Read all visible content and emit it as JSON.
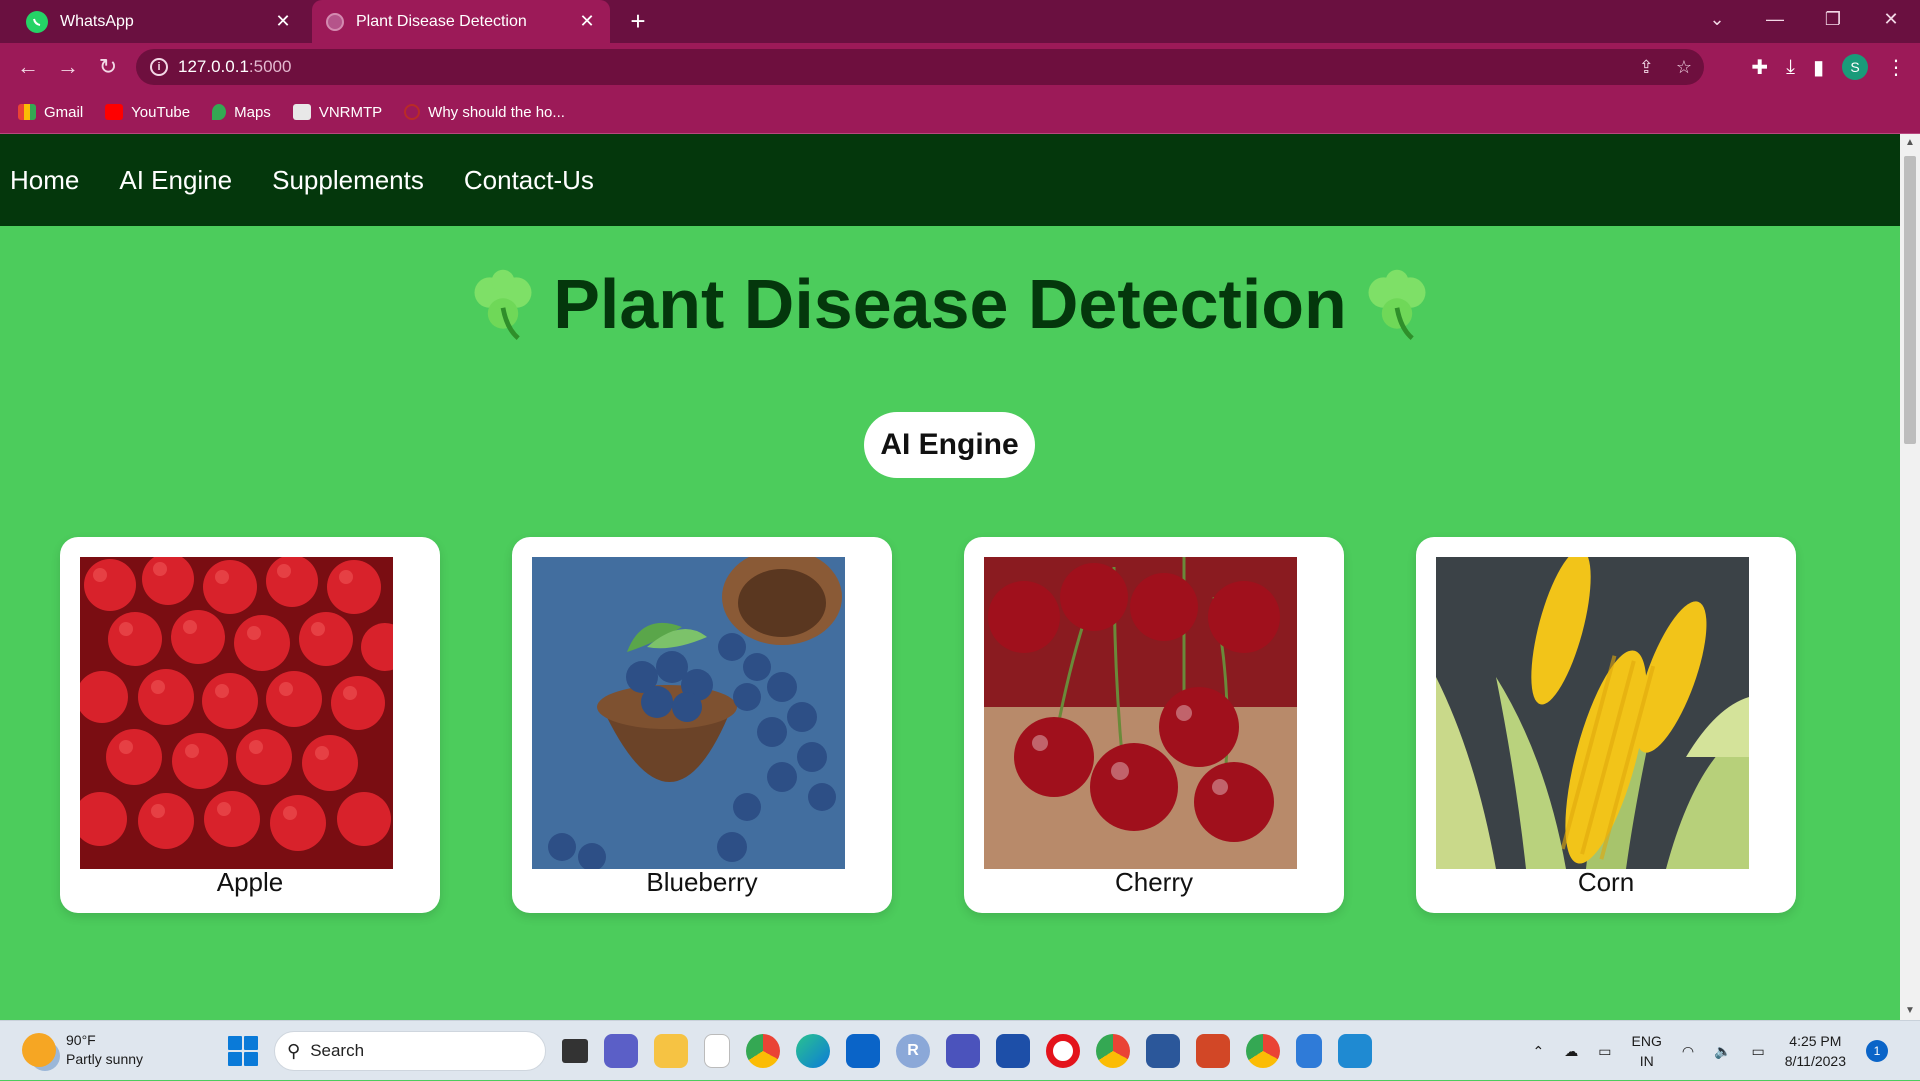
{
  "browser": {
    "tabs": [
      {
        "title": "WhatsApp",
        "active": false
      },
      {
        "title": "Plant Disease Detection",
        "active": true
      }
    ],
    "url_host": "127.0.0.1",
    "url_port": ":5000",
    "profile_initial": "S",
    "bookmarks": [
      "Gmail",
      "YouTube",
      "Maps",
      "VNRMTP",
      "Why should the ho..."
    ]
  },
  "site": {
    "nav": [
      "Home",
      "AI Engine",
      "Supplements",
      "Contact-Us"
    ],
    "title": "Plant Disease Detection",
    "engine_button": "AI Engine",
    "cards": [
      {
        "label": "Apple"
      },
      {
        "label": "Blueberry"
      },
      {
        "label": "Cherry"
      },
      {
        "label": "Corn"
      }
    ]
  },
  "taskbar": {
    "temperature": "90°F",
    "weather": "Partly sunny",
    "search_placeholder": "Search",
    "lang_top": "ENG",
    "lang_bottom": "IN",
    "time": "4:25 PM",
    "date": "8/11/2023",
    "notifications": "1"
  },
  "colors": {
    "tab_strip": "#6a1040",
    "toolbar": "#9c1a58",
    "site_nav": "#04370c",
    "page_bg": "#4ccc5c"
  }
}
